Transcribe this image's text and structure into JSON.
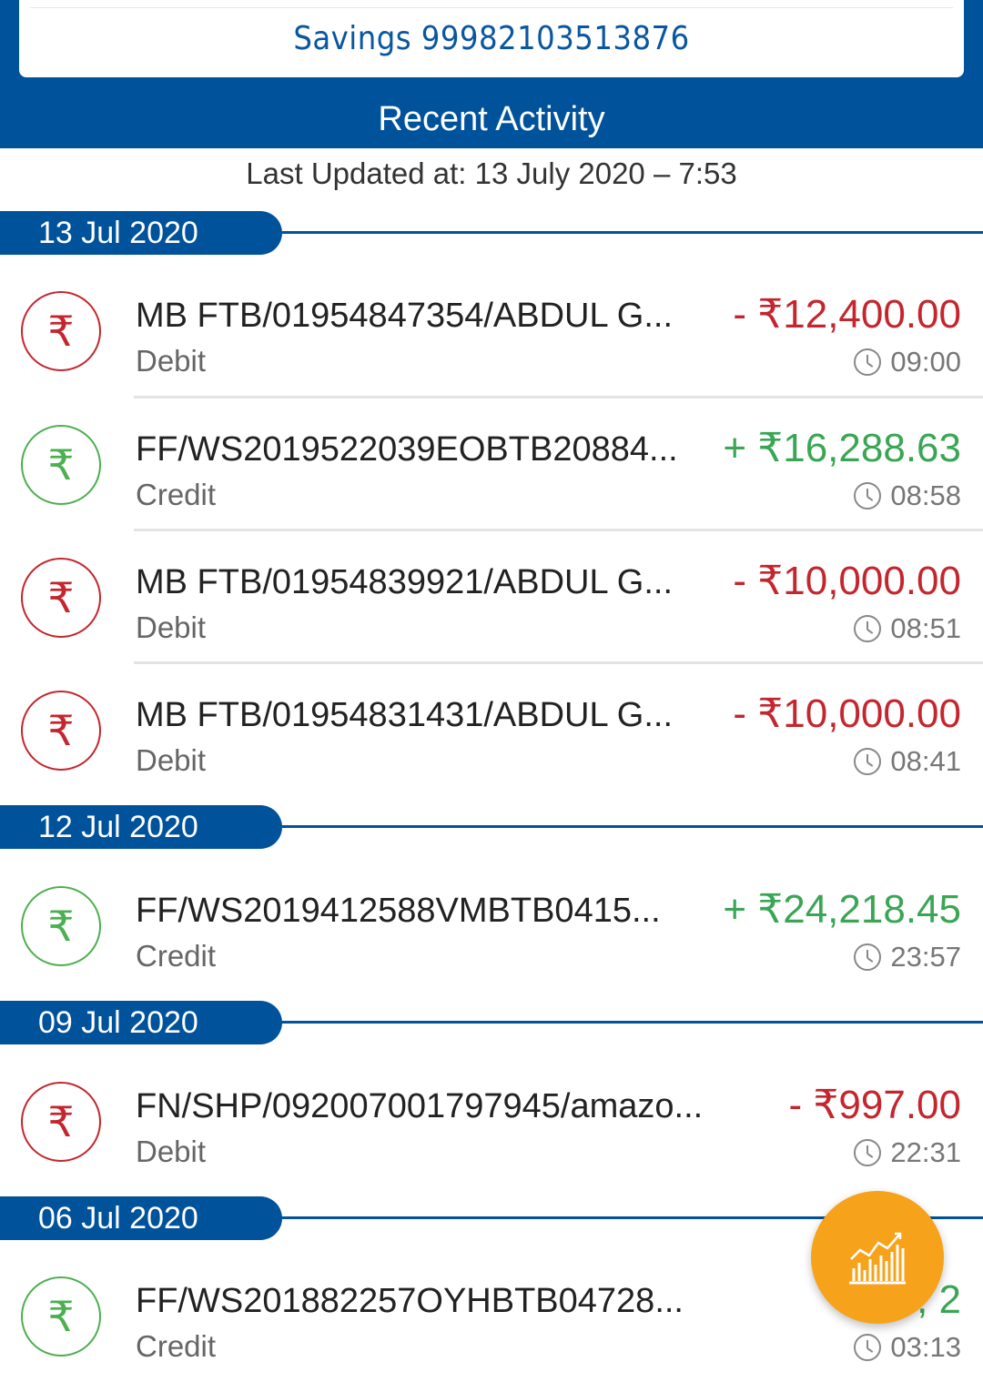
{
  "account": {
    "label": "Savings 99982103513876"
  },
  "section_title": "Recent Activity",
  "last_updated": "Last Updated at: 13 July 2020 – 7:53",
  "groups": [
    {
      "date": "13 Jul 2020",
      "transactions": [
        {
          "desc": "MB FTB/01954847354/ABDUL G...",
          "type": "Debit",
          "amount": "- ₹12,400.00",
          "time": "09:00"
        },
        {
          "desc": "FF/WS2019522039EOBTB20884...",
          "type": "Credit",
          "amount": "+ ₹16,288.63",
          "time": "08:58"
        },
        {
          "desc": "MB FTB/01954839921/ABDUL G...",
          "type": "Debit",
          "amount": "- ₹10,000.00",
          "time": "08:51"
        },
        {
          "desc": "MB FTB/01954831431/ABDUL G...",
          "type": "Debit",
          "amount": "- ₹10,000.00",
          "time": "08:41"
        }
      ]
    },
    {
      "date": "12 Jul 2020",
      "transactions": [
        {
          "desc": "FF/WS2019412588VMBTB0415...",
          "type": "Credit",
          "amount": "+ ₹24,218.45",
          "time": "23:57"
        }
      ]
    },
    {
      "date": "09 Jul 2020",
      "transactions": [
        {
          "desc": "FN/SHP/092007001797945/amazo...",
          "type": "Debit",
          "amount": "- ₹997.00",
          "time": "22:31"
        }
      ]
    },
    {
      "date": "06 Jul 2020",
      "transactions": [
        {
          "desc": "FF/WS201882257OYHBTB04728...",
          "type": "Credit",
          "amount": "+ ₹8,   2",
          "time": "03:13"
        }
      ]
    }
  ],
  "icons": {
    "rupee": "₹",
    "fab": "bar-chart-icon",
    "clock": "clock-icon"
  },
  "colors": {
    "brand": "#00529b",
    "debit": "#c4262e",
    "credit": "#3aa655",
    "fab": "#f7a21b"
  }
}
